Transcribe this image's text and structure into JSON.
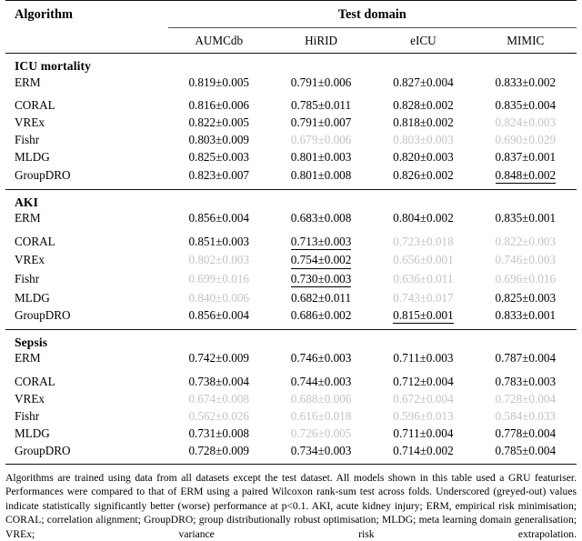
{
  "table": {
    "header": {
      "algorithm_label": "Algorithm",
      "group_label": "Test domain",
      "domains": [
        "AUMCdb",
        "HiRID",
        "eICU",
        "MIMIC"
      ]
    },
    "sections": [
      {
        "title": "ICU mortality",
        "rows": [
          {
            "algorithm": "ERM",
            "cells": [
              {
                "value": "0.819±0.005",
                "style": "normal"
              },
              {
                "value": "0.791±0.006",
                "style": "normal"
              },
              {
                "value": "0.827±0.004",
                "style": "normal"
              },
              {
                "value": "0.833±0.002",
                "style": "normal"
              }
            ]
          },
          {
            "algorithm": "CORAL",
            "cells": [
              {
                "value": "0.816±0.006",
                "style": "normal"
              },
              {
                "value": "0.785±0.011",
                "style": "normal"
              },
              {
                "value": "0.828±0.002",
                "style": "normal"
              },
              {
                "value": "0.835±0.004",
                "style": "normal"
              }
            ]
          },
          {
            "algorithm": "VREx",
            "cells": [
              {
                "value": "0.822±0.005",
                "style": "normal"
              },
              {
                "value": "0.791±0.007",
                "style": "normal"
              },
              {
                "value": "0.818±0.002",
                "style": "normal"
              },
              {
                "value": "0.824±0.003",
                "style": "grey"
              }
            ]
          },
          {
            "algorithm": "Fishr",
            "cells": [
              {
                "value": "0.803±0.009",
                "style": "normal"
              },
              {
                "value": "0.679±0.006",
                "style": "grey"
              },
              {
                "value": "0.803±0.003",
                "style": "grey"
              },
              {
                "value": "0.690±0.029",
                "style": "grey"
              }
            ]
          },
          {
            "algorithm": "MLDG",
            "cells": [
              {
                "value": "0.825±0.003",
                "style": "normal"
              },
              {
                "value": "0.801±0.003",
                "style": "normal"
              },
              {
                "value": "0.820±0.003",
                "style": "normal"
              },
              {
                "value": "0.837±0.001",
                "style": "normal"
              }
            ]
          },
          {
            "algorithm": "GroupDRO",
            "cells": [
              {
                "value": "0.823±0.007",
                "style": "normal"
              },
              {
                "value": "0.801±0.008",
                "style": "normal"
              },
              {
                "value": "0.826±0.002",
                "style": "normal"
              },
              {
                "value": "0.848±0.002",
                "style": "underline"
              }
            ]
          }
        ]
      },
      {
        "title": "AKI",
        "rows": [
          {
            "algorithm": "ERM",
            "cells": [
              {
                "value": "0.856±0.004",
                "style": "normal"
              },
              {
                "value": "0.683±0.008",
                "style": "normal"
              },
              {
                "value": "0.804±0.002",
                "style": "normal"
              },
              {
                "value": "0.835±0.001",
                "style": "normal"
              }
            ]
          },
          {
            "algorithm": "CORAL",
            "cells": [
              {
                "value": "0.851±0.003",
                "style": "normal"
              },
              {
                "value": "0.713±0.003",
                "style": "underline"
              },
              {
                "value": "0.723±0.018",
                "style": "grey"
              },
              {
                "value": "0.822±0.003",
                "style": "grey"
              }
            ]
          },
          {
            "algorithm": "VREx",
            "cells": [
              {
                "value": "0.802±0.003",
                "style": "grey"
              },
              {
                "value": "0.754±0.002",
                "style": "underline"
              },
              {
                "value": "0.656±0.001",
                "style": "grey"
              },
              {
                "value": "0.746±0.003",
                "style": "grey"
              }
            ]
          },
          {
            "algorithm": "Fishr",
            "cells": [
              {
                "value": "0.699±0.016",
                "style": "grey"
              },
              {
                "value": "0.730±0.003",
                "style": "underline"
              },
              {
                "value": "0.636±0.011",
                "style": "grey"
              },
              {
                "value": "0.696±0.016",
                "style": "grey"
              }
            ]
          },
          {
            "algorithm": "MLDG",
            "cells": [
              {
                "value": "0.840±0.006",
                "style": "grey"
              },
              {
                "value": "0.682±0.011",
                "style": "normal"
              },
              {
                "value": "0.743±0.017",
                "style": "grey"
              },
              {
                "value": "0.825±0.003",
                "style": "normal"
              }
            ]
          },
          {
            "algorithm": "GroupDRO",
            "cells": [
              {
                "value": "0.856±0.004",
                "style": "normal"
              },
              {
                "value": "0.686±0.002",
                "style": "normal"
              },
              {
                "value": "0.815±0.001",
                "style": "underline"
              },
              {
                "value": "0.833±0.001",
                "style": "normal"
              }
            ]
          }
        ]
      },
      {
        "title": "Sepsis",
        "rows": [
          {
            "algorithm": "ERM",
            "cells": [
              {
                "value": "0.742±0.009",
                "style": "normal"
              },
              {
                "value": "0.746±0.003",
                "style": "normal"
              },
              {
                "value": "0.711±0.003",
                "style": "normal"
              },
              {
                "value": "0.787±0.004",
                "style": "normal"
              }
            ]
          },
          {
            "algorithm": "CORAL",
            "cells": [
              {
                "value": "0.738±0.004",
                "style": "normal"
              },
              {
                "value": "0.744±0.003",
                "style": "normal"
              },
              {
                "value": "0.712±0.004",
                "style": "normal"
              },
              {
                "value": "0.783±0.003",
                "style": "normal"
              }
            ]
          },
          {
            "algorithm": "VREx",
            "cells": [
              {
                "value": "0.674±0.008",
                "style": "grey"
              },
              {
                "value": "0.688±0.006",
                "style": "grey"
              },
              {
                "value": "0.672±0.004",
                "style": "grey"
              },
              {
                "value": "0.728±0.004",
                "style": "grey"
              }
            ]
          },
          {
            "algorithm": "Fishr",
            "cells": [
              {
                "value": "0.562±0.026",
                "style": "grey"
              },
              {
                "value": "0.616±0.018",
                "style": "grey"
              },
              {
                "value": "0.596±0.013",
                "style": "grey"
              },
              {
                "value": "0.584±0.033",
                "style": "grey"
              }
            ]
          },
          {
            "algorithm": "MLDG",
            "cells": [
              {
                "value": "0.731±0.008",
                "style": "normal"
              },
              {
                "value": "0.726±0.005",
                "style": "grey"
              },
              {
                "value": "0.711±0.004",
                "style": "normal"
              },
              {
                "value": "0.778±0.004",
                "style": "normal"
              }
            ]
          },
          {
            "algorithm": "GroupDRO",
            "cells": [
              {
                "value": "0.728±0.009",
                "style": "normal"
              },
              {
                "value": "0.734±0.003",
                "style": "normal"
              },
              {
                "value": "0.714±0.002",
                "style": "normal"
              },
              {
                "value": "0.785±0.004",
                "style": "normal"
              }
            ]
          }
        ]
      }
    ]
  },
  "caption": "Algorithms are trained using data from all datasets except the test dataset. All models shown in this table used a GRU featuriser. Performances were compared to that of ERM using a paired Wilcoxon rank-sum test across folds. Underscored (greyed-out) values indicate statistically significantly better (worse) performance at p<0.1. AKI, acute kidney injury; ERM, empirical risk minimisation; CORAL; correlation alignment; GroupDRO; group distributionally robust optimisation; MLDG; meta learning domain generalisation; VREx; variance risk extrapolation."
}
